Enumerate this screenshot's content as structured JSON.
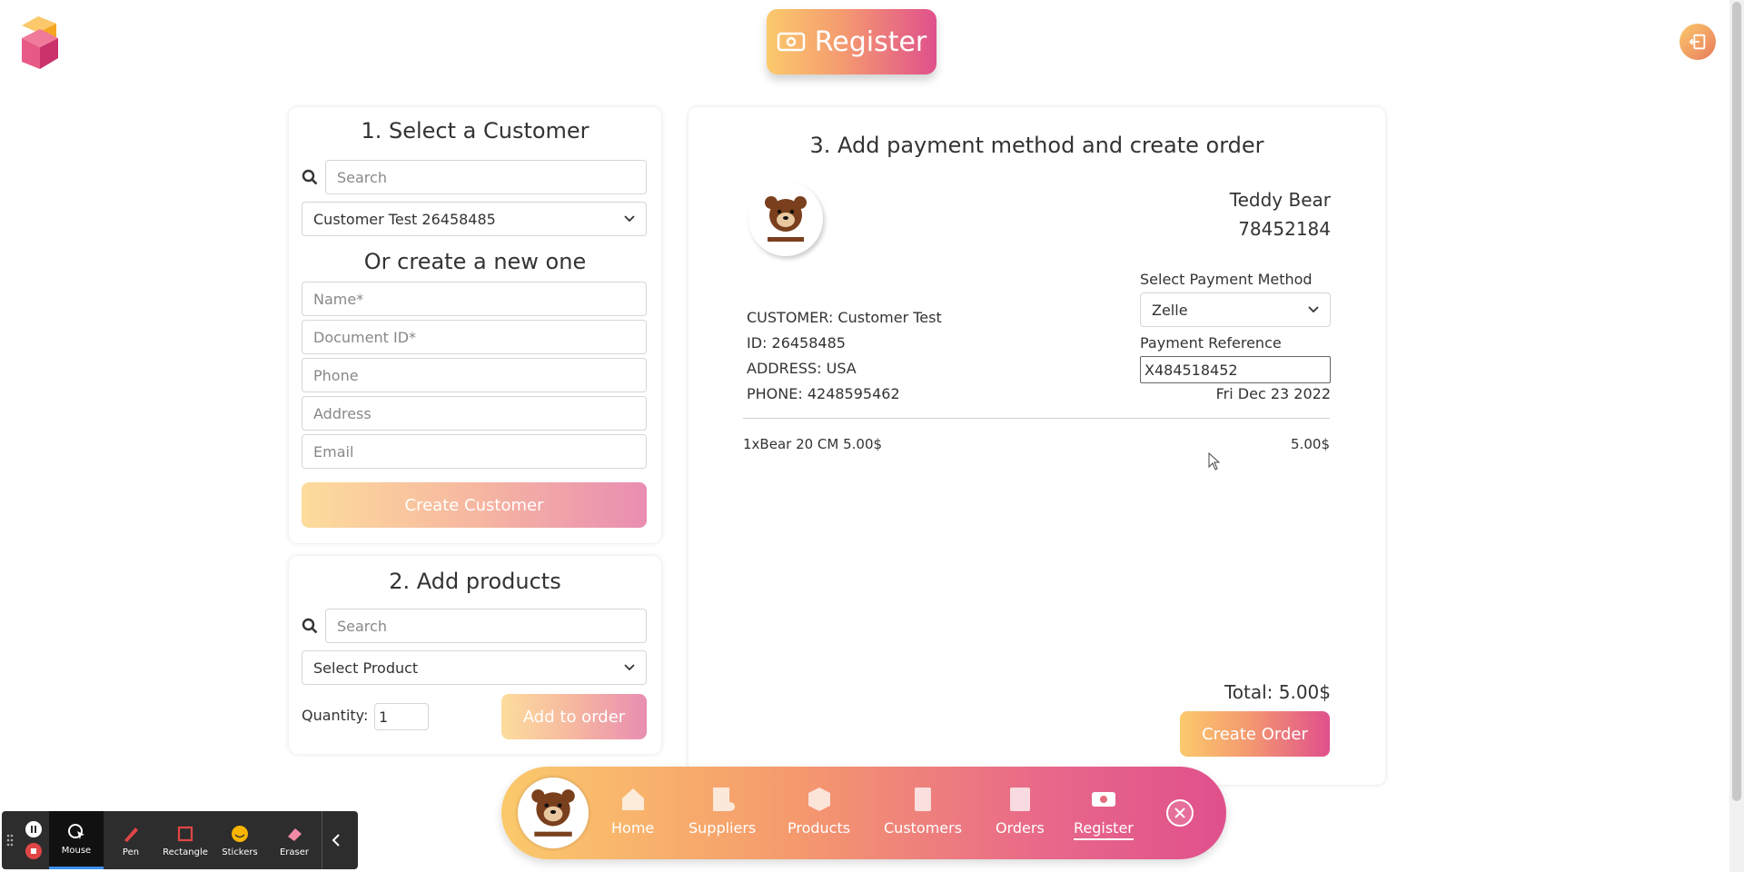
{
  "header": {
    "title": "Register",
    "logo_icon": "cube-logo-icon",
    "logout_icon": "logout-icon"
  },
  "customer_section": {
    "title": "1. Select a Customer",
    "search_placeholder": "Search",
    "selected_customer": "Customer Test 26458485",
    "create_title": "Or create a new one",
    "name_placeholder": "Name*",
    "document_placeholder": "Document ID*",
    "phone_placeholder": "Phone",
    "address_placeholder": "Address",
    "email_placeholder": "Email",
    "create_button": "Create Customer"
  },
  "products_section": {
    "title": "2. Add products",
    "search_placeholder": "Search",
    "selected_product": "Select Product",
    "quantity_label": "Quantity:",
    "quantity_value": "1",
    "add_button": "Add to order"
  },
  "order_section": {
    "title": "3. Add payment method and create order",
    "store_name": "Teddy Bear",
    "store_id": "78452184",
    "customer_line": "CUSTOMER: Customer Test",
    "id_line": "ID: 26458485",
    "address_line": "ADDRESS: USA",
    "phone_line": "PHONE: 4248595462",
    "payment_method_label": "Select Payment Method",
    "payment_method_value": "Zelle",
    "payment_reference_label": "Payment Reference",
    "payment_reference_value": "X484518452",
    "date": "Fri Dec 23 2022",
    "items": [
      {
        "description": "1xBear 20 CM 5.00$",
        "amount": "5.00$"
      }
    ],
    "total": "Total: 5.00$",
    "create_button": "Create Order"
  },
  "bottom_nav": {
    "items": [
      {
        "label": "Home",
        "icon": "home-icon"
      },
      {
        "label": "Suppliers",
        "icon": "suppliers-icon"
      },
      {
        "label": "Products",
        "icon": "box-icon"
      },
      {
        "label": "Customers",
        "icon": "badge-icon"
      },
      {
        "label": "Orders",
        "icon": "list-icon"
      },
      {
        "label": "Register",
        "icon": "cash-icon"
      }
    ],
    "active": "Register"
  },
  "recording_toolbar": {
    "tools": [
      "Mouse",
      "Pen",
      "Rectangle",
      "Stickers",
      "Eraser"
    ],
    "active_tool": "Mouse"
  },
  "colors": {
    "gradient_start": "#fbc96b",
    "gradient_mid": "#f49a70",
    "gradient_end": "#e0508c"
  }
}
